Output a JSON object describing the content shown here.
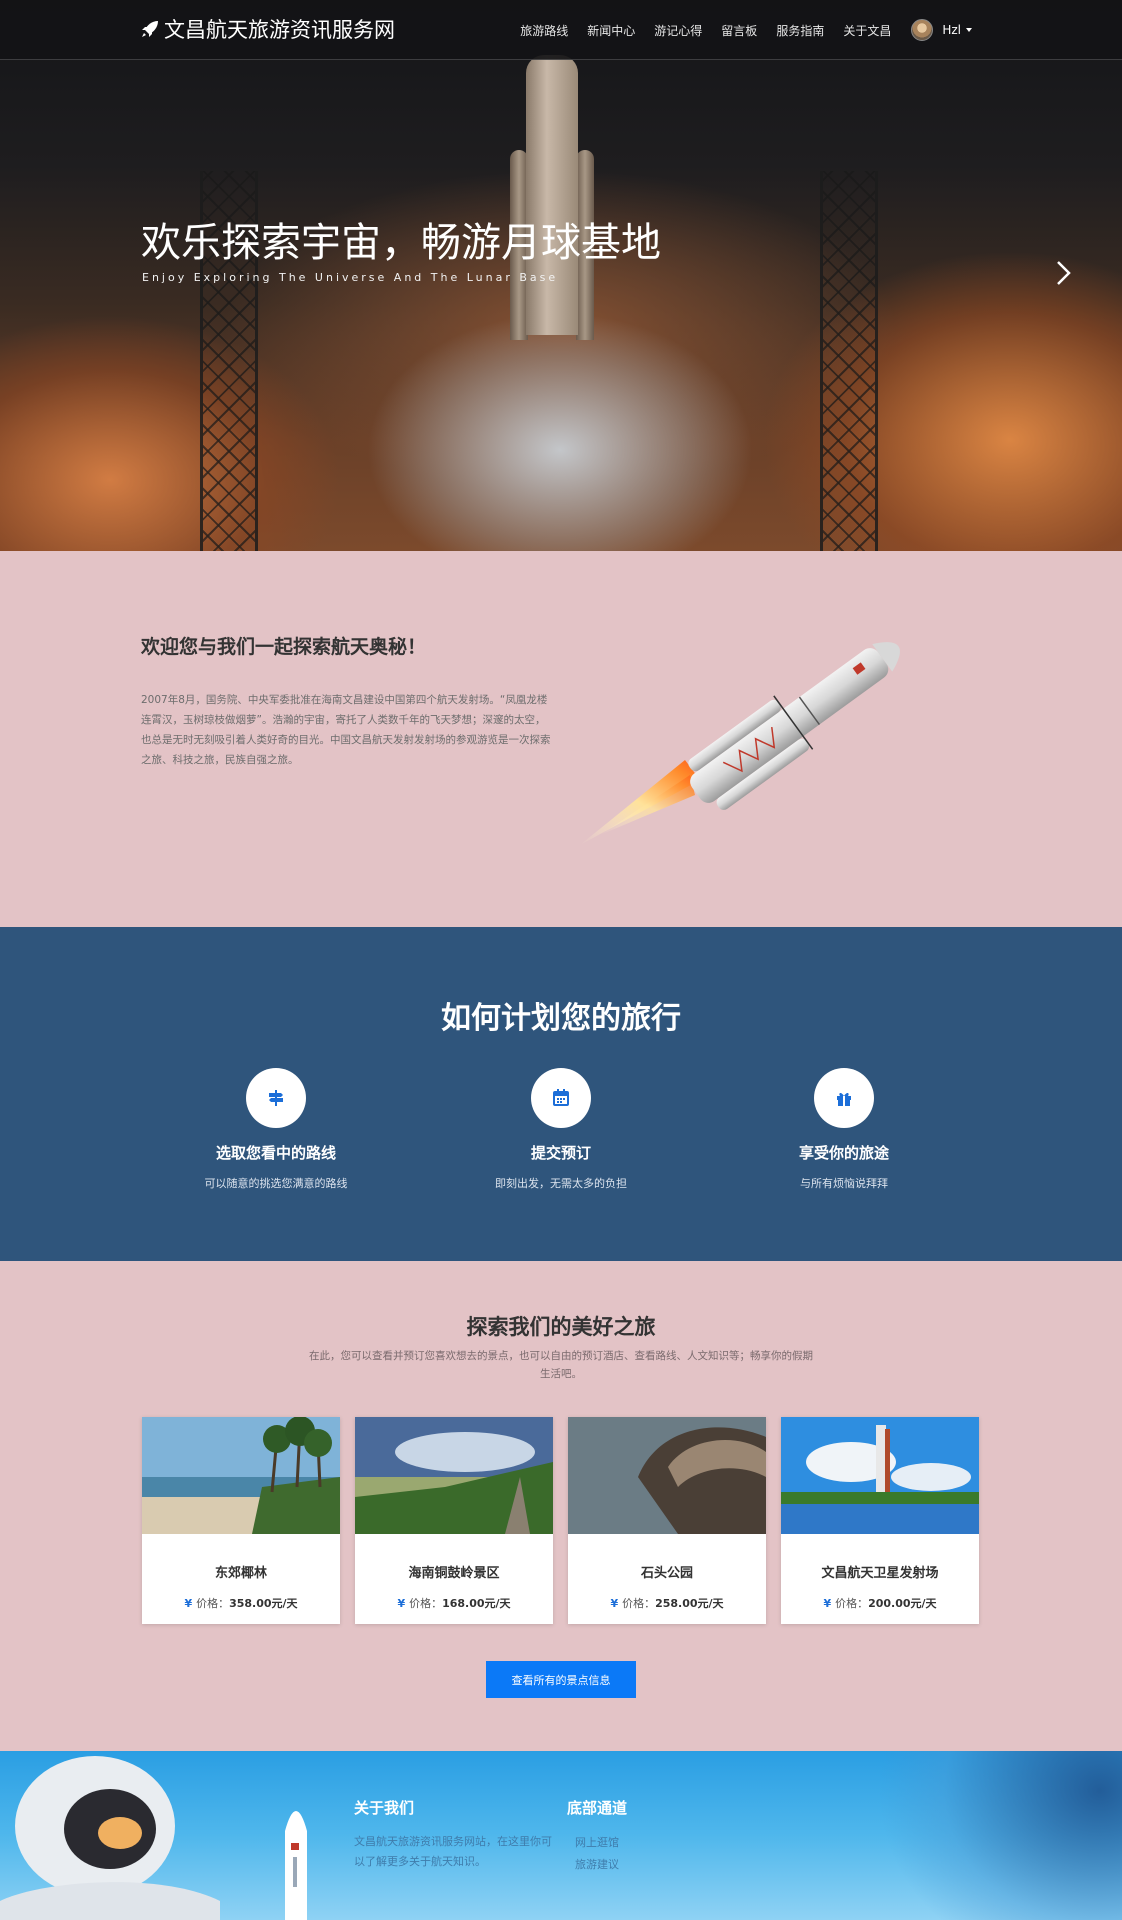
{
  "navbar": {
    "brand": "文昌航天旅游资讯服务网",
    "items": [
      "旅游路线",
      "新闻中心",
      "游记心得",
      "留言板",
      "服务指南",
      "关于文昌"
    ],
    "user": "Hzl"
  },
  "hero": {
    "title": "欢乐探索宇宙，畅游月球基地",
    "subtitle": "Enjoy Exploring The Universe And The Lunar Base"
  },
  "about": {
    "title": "欢迎您与我们一起探索航天奥秘！",
    "text": "2007年8月，国务院、中央军委批准在海南文昌建设中国第四个航天发射场。“凤凰龙楼连霄汉，玉树琼枝做烟萝”。浩瀚的宇宙，寄托了人类数千年的飞天梦想；深邃的太空，也总是无时无刻吸引着人类好奇的目光。中国文昌航天发射发射场的参观游览是一次探索之旅、科技之旅，民族自强之旅。"
  },
  "plan": {
    "title": "如何计划您的旅行",
    "steps": [
      {
        "icon": "signpost-icon",
        "title": "选取您看中的路线",
        "text": "可以随意的挑选您满意的路线"
      },
      {
        "icon": "calendar-icon",
        "title": "提交预订",
        "text": "即刻出发，无需太多的负担"
      },
      {
        "icon": "gift-icon",
        "title": "享受你的旅途",
        "text": "与所有烦恼说拜拜"
      }
    ]
  },
  "explore": {
    "title": "探索我们的美好之旅",
    "subtitle": "在此，您可以查看并预订您喜欢想去的景点，也可以自由的预订酒店、查看路线、人文知识等；畅享你的假期生活吧。",
    "price_label": "价格：",
    "currency": "¥",
    "cards": [
      {
        "name": "东郊椰林",
        "price": "358.00元/天"
      },
      {
        "name": "海南铜鼓岭景区",
        "price": "168.00元/天"
      },
      {
        "name": "石头公园",
        "price": "258.00元/天"
      },
      {
        "name": "文昌航天卫星发射场",
        "price": "200.00元/天"
      }
    ],
    "button": "查看所有的景点信息"
  },
  "footer": {
    "about_title": "关于我们",
    "about_text": "文昌航天旅游资讯服务网站，在这里你可以了解更多关于航天知识。",
    "links_title": "底部通道",
    "links": [
      "网上逛馆",
      "旅游建议"
    ]
  },
  "colors": {
    "accent": "#0b79f7",
    "plan_bg": "#2f557c",
    "page_bg": "#e3c3c6"
  }
}
